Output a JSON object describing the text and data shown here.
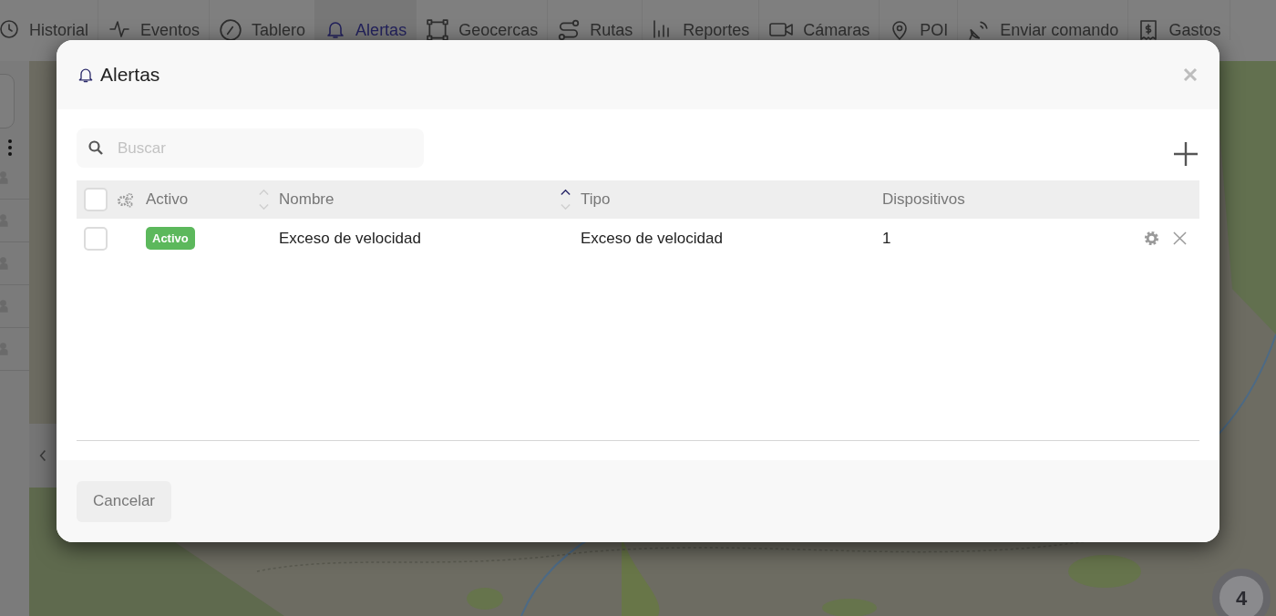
{
  "nav": {
    "tabs": [
      {
        "label": "Historial",
        "selected": false
      },
      {
        "label": "Eventos",
        "selected": false
      },
      {
        "label": "Tablero",
        "selected": false
      },
      {
        "label": "Alertas",
        "selected": true
      },
      {
        "label": "Geocercas",
        "selected": false
      },
      {
        "label": "Rutas",
        "selected": false
      },
      {
        "label": "Reportes",
        "selected": false
      },
      {
        "label": "Cámaras",
        "selected": false
      },
      {
        "label": "POI",
        "selected": false
      },
      {
        "label": "Enviar comando",
        "selected": false
      },
      {
        "label": "Gastos",
        "selected": false
      }
    ]
  },
  "map": {
    "kind": "picture",
    "cluster": "4"
  },
  "dialog": {
    "title": "Alertas",
    "search": {
      "placeholder": "Buscar"
    },
    "table": {
      "columns": [
        {
          "label": "Activo",
          "sorted": false
        },
        {
          "label": "Nombre",
          "sorted": true,
          "ascending": true
        },
        {
          "label": "Tipo"
        },
        {
          "label": "Dispositivos"
        }
      ],
      "select_all": false,
      "rows": [
        {
          "checked": false,
          "status": {
            "label": "Activo",
            "active": true
          },
          "nombre": "Exceso de velocidad",
          "tipo": "Exceso de velocidad",
          "dispositivos": "1"
        }
      ]
    },
    "buttons": [
      {
        "label": "Cancelar"
      }
    ]
  }
}
